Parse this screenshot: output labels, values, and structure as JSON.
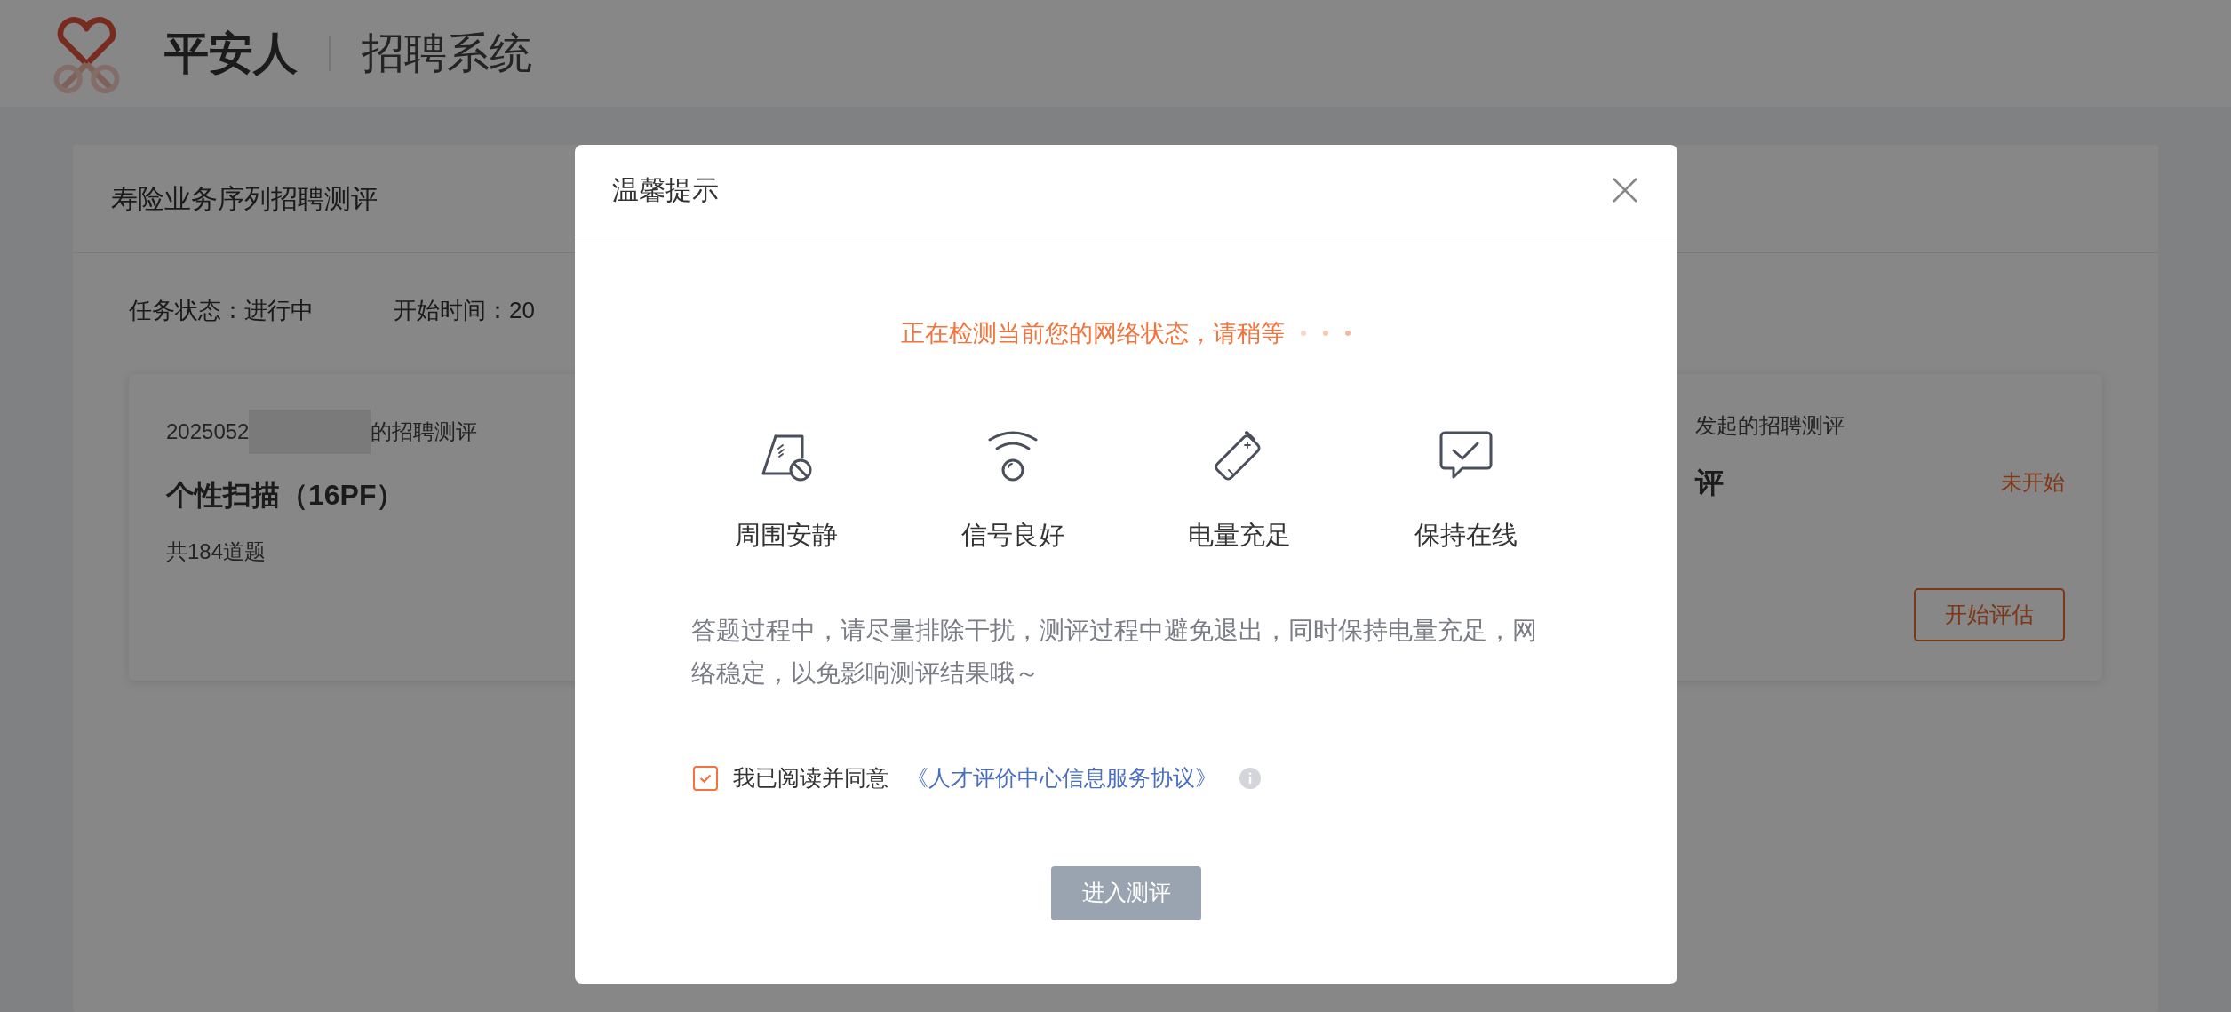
{
  "header": {
    "brand": "平安人",
    "system": "招聘系统"
  },
  "page": {
    "title": "寿险业务序列招聘测评",
    "task_status": "任务状态：进行中",
    "start_time": "开始时间：20"
  },
  "cards": [
    {
      "kind": "left",
      "source_start": "2025052",
      "source_end": "的招聘测评",
      "name": "个性扫描（16PF）",
      "count": "共184道题"
    },
    {
      "kind": "right",
      "source": "发起的招聘测评",
      "name": "评",
      "status": "未开始",
      "button": "开始评估"
    }
  ],
  "dialog": {
    "title": "温馨提示",
    "status_message": "正在检测当前您的网络状态，请稍等",
    "tips": [
      {
        "kind": "quiet",
        "label": "周围安静"
      },
      {
        "kind": "signal",
        "label": "信号良好"
      },
      {
        "kind": "battery",
        "label": "电量充足"
      },
      {
        "kind": "online",
        "label": "保持在线"
      }
    ],
    "notice": "答题过程中，请尽量排除干扰，测评过程中避免退出，同时保持电量充足，网络稳定，以免影响测评结果哦～",
    "agreement": {
      "checked": true,
      "label": "我已阅读并同意",
      "link": "《人才评价中心信息服务协议》"
    },
    "submit": {
      "label": "进入测评",
      "disabled": true
    }
  }
}
